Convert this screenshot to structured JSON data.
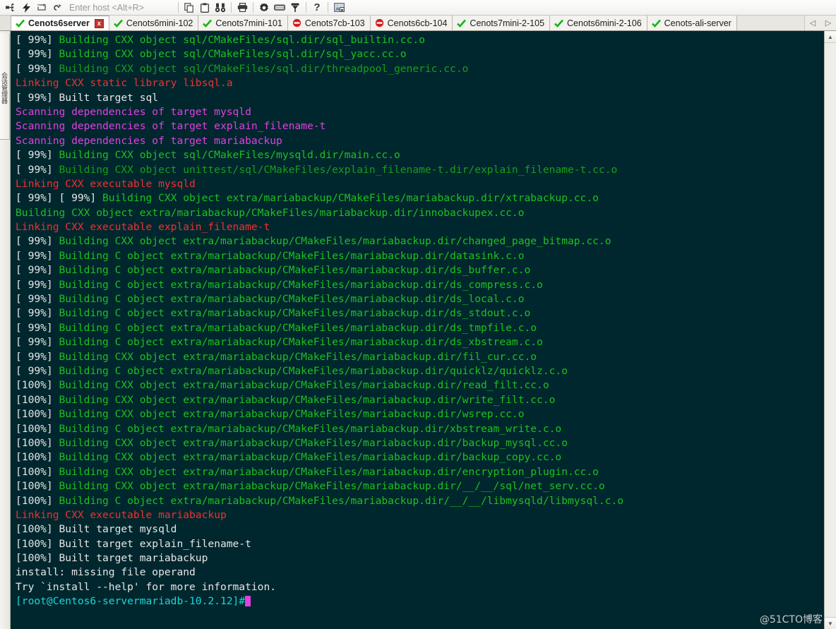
{
  "toolbar": {
    "icons_left": [
      {
        "name": "connect-icon",
        "glyph": "connect"
      },
      {
        "name": "quick-connect-icon",
        "glyph": "bolt"
      },
      {
        "name": "reconnect-icon",
        "glyph": "loop"
      },
      {
        "name": "disconnect-icon",
        "glyph": "unlink"
      }
    ],
    "host_input": {
      "value": "",
      "placeholder": "Enter host <Alt+R>"
    },
    "icons_right": [
      {
        "name": "copy-icon",
        "glyph": "copy"
      },
      {
        "name": "paste-icon",
        "glyph": "clipboard"
      },
      {
        "name": "find-icon",
        "glyph": "binoculars"
      },
      {
        "name": "print-icon",
        "glyph": "printer"
      },
      {
        "name": "settings-icon",
        "glyph": "gear"
      },
      {
        "name": "keyboard-icon",
        "glyph": "keyboard"
      },
      {
        "name": "filter-icon",
        "glyph": "funnel"
      },
      {
        "name": "help-icon",
        "glyph": "question"
      },
      {
        "name": "screenshot-icon",
        "glyph": "image"
      }
    ]
  },
  "sidebar": {
    "panel_label": "会话管理器"
  },
  "tabs": [
    {
      "label": "Cenots6server",
      "status": "connected",
      "active": true,
      "close": "x"
    },
    {
      "label": "Cenots6mini-102",
      "status": "connected",
      "active": false
    },
    {
      "label": "Cenots7mini-101",
      "status": "connected",
      "active": false
    },
    {
      "label": "Cenots7cb-103",
      "status": "disconnected",
      "active": false
    },
    {
      "label": "Cenots6cb-104",
      "status": "disconnected",
      "active": false
    },
    {
      "label": "Cenots7mini-2-105",
      "status": "connected",
      "active": false
    },
    {
      "label": "Cenots6mini-2-106",
      "status": "connected",
      "active": false
    },
    {
      "label": "Cenots-ali-server",
      "status": "connected",
      "active": false
    }
  ],
  "tab_nav": {
    "prev": "◁",
    "next": "▷"
  },
  "scrollbar": {
    "up": "▲",
    "down": "▼"
  },
  "watermark": "@51CTO博客",
  "colors": {
    "terminal_bg": "#00272e",
    "white": "#e6e6e6",
    "green": "#1ec01e",
    "dim_green": "#179e17",
    "red": "#f03030",
    "magenta": "#e040e0",
    "cyan": "#19d7d7"
  },
  "terminal": {
    "prompt": "[root@Centos6-servermariadb-10.2.12]#",
    "lines": [
      [
        {
          "t": "[ 99%] ",
          "c": "white"
        },
        {
          "t": "Building CXX object sql/CMakeFiles/sql.dir/sql_builtin.cc.o",
          "c": "green"
        }
      ],
      [
        {
          "t": "[ 99%] ",
          "c": "white"
        },
        {
          "t": "Building CXX object sql/CMakeFiles/sql.dir/sql_yacc.cc.o",
          "c": "green"
        }
      ],
      [
        {
          "t": "[ 99%] ",
          "c": "white"
        },
        {
          "t": "Building CXX object sql/CMakeFiles/sql.dir/threadpool_generic.cc.o",
          "c": "dgreen"
        }
      ],
      [
        {
          "t": "Linking CXX static library libsql.a",
          "c": "red"
        }
      ],
      [
        {
          "t": "[ 99%] Built target sql",
          "c": "white"
        }
      ],
      [
        {
          "t": "Scanning dependencies of target mysqld",
          "c": "magenta"
        }
      ],
      [
        {
          "t": "Scanning dependencies of target explain_filename-t",
          "c": "magenta"
        }
      ],
      [
        {
          "t": "Scanning dependencies of target mariabackup",
          "c": "magenta"
        }
      ],
      [
        {
          "t": "[ 99%] ",
          "c": "white"
        },
        {
          "t": "Building CXX object sql/CMakeFiles/mysqld.dir/main.cc.o",
          "c": "green"
        }
      ],
      [
        {
          "t": "[ 99%] ",
          "c": "white"
        },
        {
          "t": "Building CXX object unittest/sql/CMakeFiles/explain_filename-t.dir/explain_filename-t.cc.o",
          "c": "dgreen"
        }
      ],
      [
        {
          "t": "Linking CXX executable mysqld",
          "c": "red"
        }
      ],
      [
        {
          "t": "[ 99%] [ 99%] ",
          "c": "white"
        },
        {
          "t": "Building CXX object extra/mariabackup/CMakeFiles/mariabackup.dir/xtrabackup.cc.o",
          "c": "green"
        }
      ],
      [
        {
          "t": "Building CXX object extra/mariabackup/CMakeFiles/mariabackup.dir/innobackupex.cc.o",
          "c": "green"
        }
      ],
      [
        {
          "t": "Linking CXX executable explain_filename-t",
          "c": "red"
        }
      ],
      [
        {
          "t": "[ 99%] ",
          "c": "white"
        },
        {
          "t": "Building CXX object extra/mariabackup/CMakeFiles/mariabackup.dir/changed_page_bitmap.cc.o",
          "c": "green"
        }
      ],
      [
        {
          "t": "[ 99%] ",
          "c": "white"
        },
        {
          "t": "Building C object extra/mariabackup/CMakeFiles/mariabackup.dir/datasink.c.o",
          "c": "green"
        }
      ],
      [
        {
          "t": "[ 99%] ",
          "c": "white"
        },
        {
          "t": "Building C object extra/mariabackup/CMakeFiles/mariabackup.dir/ds_buffer.c.o",
          "c": "green"
        }
      ],
      [
        {
          "t": "[ 99%] ",
          "c": "white"
        },
        {
          "t": "Building C object extra/mariabackup/CMakeFiles/mariabackup.dir/ds_compress.c.o",
          "c": "green"
        }
      ],
      [
        {
          "t": "[ 99%] ",
          "c": "white"
        },
        {
          "t": "Building C object extra/mariabackup/CMakeFiles/mariabackup.dir/ds_local.c.o",
          "c": "green"
        }
      ],
      [
        {
          "t": "[ 99%] ",
          "c": "white"
        },
        {
          "t": "Building C object extra/mariabackup/CMakeFiles/mariabackup.dir/ds_stdout.c.o",
          "c": "green"
        }
      ],
      [
        {
          "t": "[ 99%] ",
          "c": "white"
        },
        {
          "t": "Building C object extra/mariabackup/CMakeFiles/mariabackup.dir/ds_tmpfile.c.o",
          "c": "green"
        }
      ],
      [
        {
          "t": "[ 99%] ",
          "c": "white"
        },
        {
          "t": "Building C object extra/mariabackup/CMakeFiles/mariabackup.dir/ds_xbstream.c.o",
          "c": "green"
        }
      ],
      [
        {
          "t": "[ 99%] ",
          "c": "white"
        },
        {
          "t": "Building CXX object extra/mariabackup/CMakeFiles/mariabackup.dir/fil_cur.cc.o",
          "c": "green"
        }
      ],
      [
        {
          "t": "[ 99%] ",
          "c": "white"
        },
        {
          "t": "Building C object extra/mariabackup/CMakeFiles/mariabackup.dir/quicklz/quicklz.c.o",
          "c": "green"
        }
      ],
      [
        {
          "t": "[100%] ",
          "c": "white"
        },
        {
          "t": "Building CXX object extra/mariabackup/CMakeFiles/mariabackup.dir/read_filt.cc.o",
          "c": "green"
        }
      ],
      [
        {
          "t": "[100%] ",
          "c": "white"
        },
        {
          "t": "Building CXX object extra/mariabackup/CMakeFiles/mariabackup.dir/write_filt.cc.o",
          "c": "green"
        }
      ],
      [
        {
          "t": "[100%] ",
          "c": "white"
        },
        {
          "t": "Building CXX object extra/mariabackup/CMakeFiles/mariabackup.dir/wsrep.cc.o",
          "c": "green"
        }
      ],
      [
        {
          "t": "[100%] ",
          "c": "white"
        },
        {
          "t": "Building C object extra/mariabackup/CMakeFiles/mariabackup.dir/xbstream_write.c.o",
          "c": "green"
        }
      ],
      [
        {
          "t": "[100%] ",
          "c": "white"
        },
        {
          "t": "Building CXX object extra/mariabackup/CMakeFiles/mariabackup.dir/backup_mysql.cc.o",
          "c": "green"
        }
      ],
      [
        {
          "t": "[100%] ",
          "c": "white"
        },
        {
          "t": "Building CXX object extra/mariabackup/CMakeFiles/mariabackup.dir/backup_copy.cc.o",
          "c": "green"
        }
      ],
      [
        {
          "t": "[100%] ",
          "c": "white"
        },
        {
          "t": "Building CXX object extra/mariabackup/CMakeFiles/mariabackup.dir/encryption_plugin.cc.o",
          "c": "green"
        }
      ],
      [
        {
          "t": "[100%] ",
          "c": "white"
        },
        {
          "t": "Building CXX object extra/mariabackup/CMakeFiles/mariabackup.dir/__/__/sql/net_serv.cc.o",
          "c": "green"
        }
      ],
      [
        {
          "t": "[100%] ",
          "c": "white"
        },
        {
          "t": "Building C object extra/mariabackup/CMakeFiles/mariabackup.dir/__/__/libmysqld/libmysql.c.o",
          "c": "green"
        }
      ],
      [
        {
          "t": "Linking CXX executable mariabackup",
          "c": "red"
        }
      ],
      [
        {
          "t": "[100%] Built target mysqld",
          "c": "white"
        }
      ],
      [
        {
          "t": "[100%] Built target explain_filename-t",
          "c": "white"
        }
      ],
      [
        {
          "t": "[100%] Built target mariabackup",
          "c": "white"
        }
      ],
      [
        {
          "t": "install: missing file operand",
          "c": "white"
        }
      ],
      [
        {
          "t": "Try `install --help' for more information.",
          "c": "white"
        }
      ]
    ]
  }
}
